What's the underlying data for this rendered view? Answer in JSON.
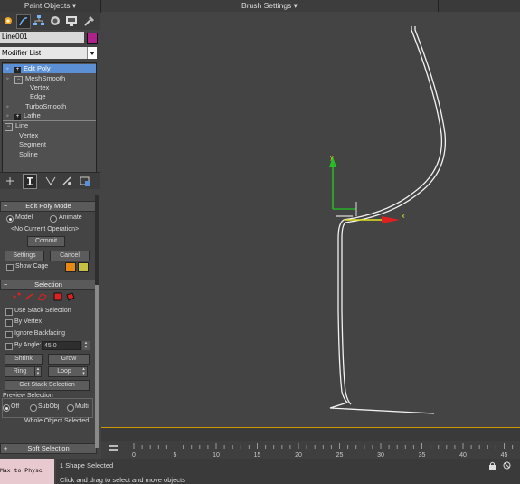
{
  "topbar": {
    "paint_objects": "Paint Objects",
    "brush_settings": "Brush Settings"
  },
  "object": {
    "name": "Line001",
    "color": "#b0208c"
  },
  "modifier_list": {
    "label": "Modifier List"
  },
  "stack": {
    "items": [
      "Edit Poly",
      "MeshSmooth",
      "Vertex",
      "Edge",
      "TurboSmooth",
      "Lathe",
      "Line",
      "Vertex",
      "Segment",
      "Spline"
    ]
  },
  "edit_poly_mode": {
    "title": "Edit Poly Mode",
    "model": "Model",
    "animate": "Animate",
    "current_op": "<No Current Operation>",
    "commit": "Commit",
    "settings": "Settings",
    "cancel": "Cancel",
    "show_cage": "Show Cage",
    "cage_colors": [
      "#e88a10",
      "#c8c040"
    ]
  },
  "selection": {
    "title": "Selection",
    "use_stack": "Use Stack Selection",
    "by_vertex": "By Vertex",
    "ignore_backfacing": "Ignore Backfacing",
    "by_angle": "By Angle:",
    "angle_value": "45.0",
    "shrink": "Shrink",
    "grow": "Grow",
    "ring": "Ring",
    "loop": "Loop",
    "get_stack": "Get Stack Selection",
    "preview": "Preview Selection",
    "off": "Off",
    "subobj": "SubObj",
    "multi": "Multi",
    "whole": "Whole Object Selected"
  },
  "soft_selection": {
    "title": "Soft Selection"
  },
  "timeline": {
    "ticks": [
      "0",
      "5",
      "10",
      "15",
      "20",
      "25",
      "30",
      "35",
      "40",
      "45"
    ]
  },
  "status": {
    "maxscript": "Max to Physc",
    "line1": "1 Shape Selected",
    "line2": "Click and drag to select and move objects"
  },
  "gizmo": {
    "axis_y": "y",
    "axis_x": "x"
  }
}
